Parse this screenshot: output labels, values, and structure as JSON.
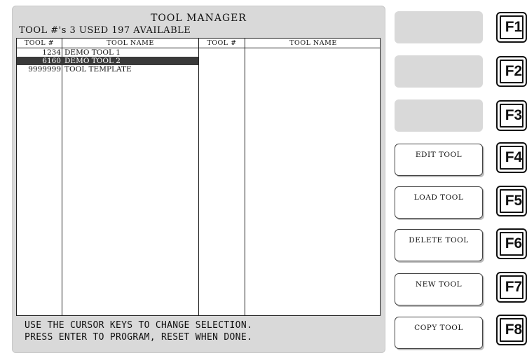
{
  "header": {
    "title": "TOOL MANAGER",
    "subtitle": "TOOL #'s 3 USED 197 AVAILABLE"
  },
  "table": {
    "columns": [
      "TOOL #",
      "TOOL NAME",
      "TOOL #",
      "TOOL NAME"
    ],
    "rows": [
      {
        "number": "1234",
        "name": "DEMO TOOL 1",
        "selected": false
      },
      {
        "number": "6160",
        "name": "DEMO TOOL 2",
        "selected": true
      },
      {
        "number": "9999999",
        "name": "TOOL TEMPLATE",
        "selected": false
      }
    ]
  },
  "status": {
    "line1": "USE THE CURSOR KEYS TO CHANGE SELECTION.",
    "line2": "PRESS ENTER TO PROGRAM, RESET WHEN DONE."
  },
  "softkeys": [
    "",
    "",
    "",
    "EDIT TOOL",
    "LOAD TOOL",
    "DELETE TOOL",
    "NEW TOOL",
    "COPY TOOL"
  ],
  "function_keys": [
    "F1",
    "F2",
    "F3",
    "F4",
    "F5",
    "F6",
    "F7",
    "F8"
  ],
  "colors": {
    "panel_bg": "#d9d9d9",
    "selection_bg": "#3a3a3a",
    "selection_text": "#ffffff"
  }
}
